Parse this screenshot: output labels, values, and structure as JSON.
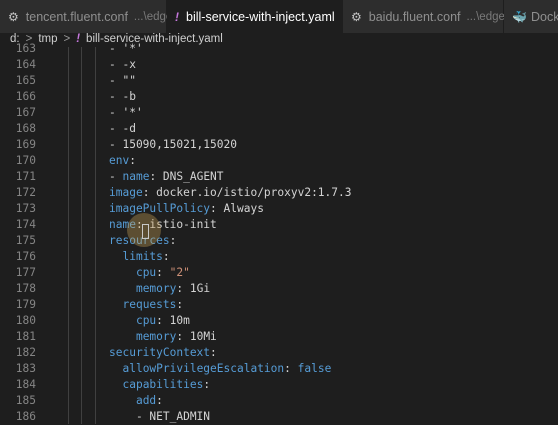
{
  "tabs": [
    {
      "icon": "gear-icon",
      "glyph": "⚙",
      "name": "tencent.fluent.conf",
      "desc": "...\\edge",
      "active": false
    },
    {
      "icon": "yaml-exclamation-icon",
      "glyph": "!",
      "name": "bill-service-with-inject.yaml",
      "desc": "",
      "active": true,
      "close": "✕"
    },
    {
      "icon": "gear-icon",
      "glyph": "⚙",
      "name": "baidu.fluent.conf",
      "desc": "...\\edge",
      "active": false
    },
    {
      "icon": "docker-icon",
      "glyph": "🐳",
      "name": "Docke",
      "desc": "",
      "active": false
    }
  ],
  "breadcrumb": {
    "drive": "d:",
    "folder": "tmp",
    "file_icon": "!",
    "file": "bill-service-with-inject.yaml",
    "sep": ">"
  },
  "lines": [
    {
      "n": "163",
      "t": [
        [
          "v",
          "- '*'"
        ]
      ]
    },
    {
      "n": "164",
      "t": [
        [
          "v",
          "- -x"
        ]
      ]
    },
    {
      "n": "165",
      "t": [
        [
          "v",
          "- \"\""
        ]
      ]
    },
    {
      "n": "166",
      "t": [
        [
          "v",
          "- -b"
        ]
      ]
    },
    {
      "n": "167",
      "t": [
        [
          "v",
          "- '*'"
        ]
      ]
    },
    {
      "n": "168",
      "t": [
        [
          "v",
          "- -d"
        ]
      ]
    },
    {
      "n": "169",
      "t": [
        [
          "v",
          "- 15090,15021,15020"
        ]
      ]
    },
    {
      "n": "170",
      "t": [
        [
          "k",
          "env"
        ],
        [
          "v",
          ":"
        ]
      ]
    },
    {
      "n": "171",
      "t": [
        [
          "v",
          "- "
        ],
        [
          "k",
          "name"
        ],
        [
          "v",
          ": DNS_AGENT"
        ]
      ]
    },
    {
      "n": "172",
      "t": [
        [
          "k",
          "image"
        ],
        [
          "v",
          ": docker.io/istio/proxyv2:1.7.3"
        ]
      ]
    },
    {
      "n": "173",
      "t": [
        [
          "k",
          "imagePullPolicy"
        ],
        [
          "v",
          ": Always"
        ]
      ]
    },
    {
      "n": "174",
      "t": [
        [
          "k",
          "name"
        ],
        [
          "v",
          ": istio-init"
        ]
      ]
    },
    {
      "n": "175",
      "t": [
        [
          "k",
          "resources"
        ],
        [
          "v",
          ":"
        ]
      ]
    },
    {
      "n": "176",
      "t": [
        [
          "v",
          "  "
        ],
        [
          "k",
          "limits"
        ],
        [
          "v",
          ":"
        ]
      ]
    },
    {
      "n": "177",
      "t": [
        [
          "v",
          "    "
        ],
        [
          "k",
          "cpu"
        ],
        [
          "v",
          ": "
        ],
        [
          "s",
          "\"2\""
        ]
      ]
    },
    {
      "n": "178",
      "t": [
        [
          "v",
          "    "
        ],
        [
          "k",
          "memory"
        ],
        [
          "v",
          ": 1Gi"
        ]
      ]
    },
    {
      "n": "179",
      "t": [
        [
          "v",
          "  "
        ],
        [
          "k",
          "requests"
        ],
        [
          "v",
          ":"
        ]
      ]
    },
    {
      "n": "180",
      "t": [
        [
          "v",
          "    "
        ],
        [
          "k",
          "cpu"
        ],
        [
          "v",
          ": 10m"
        ]
      ]
    },
    {
      "n": "181",
      "t": [
        [
          "v",
          "    "
        ],
        [
          "k",
          "memory"
        ],
        [
          "v",
          ": 10Mi"
        ]
      ]
    },
    {
      "n": "182",
      "t": [
        [
          "k",
          "securityContext"
        ],
        [
          "v",
          ":"
        ]
      ]
    },
    {
      "n": "183",
      "t": [
        [
          "v",
          "  "
        ],
        [
          "k",
          "allowPrivilegeEscalation"
        ],
        [
          "v",
          ": "
        ],
        [
          "bool",
          "false"
        ]
      ]
    },
    {
      "n": "184",
      "t": [
        [
          "v",
          "  "
        ],
        [
          "k",
          "capabilities"
        ],
        [
          "v",
          ":"
        ]
      ]
    },
    {
      "n": "185",
      "t": [
        [
          "v",
          "    "
        ],
        [
          "k",
          "add"
        ],
        [
          "v",
          ":"
        ]
      ]
    },
    {
      "n": "186",
      "t": [
        [
          "v",
          "    - NET_ADMIN"
        ]
      ]
    }
  ]
}
